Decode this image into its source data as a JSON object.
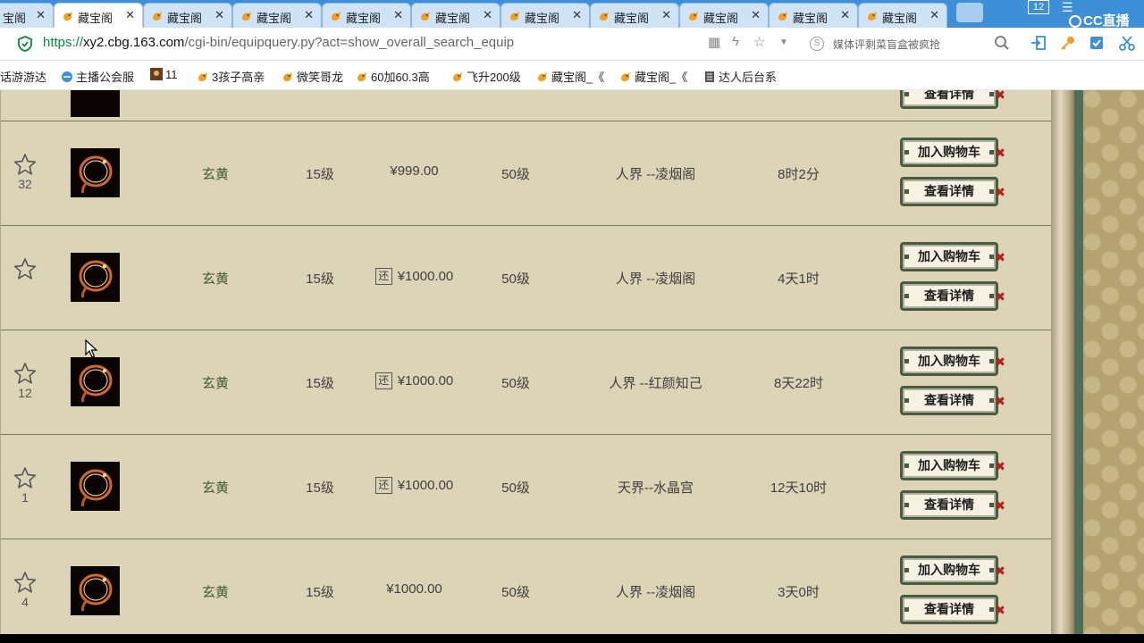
{
  "browser": {
    "tabs": [
      {
        "label": "宝阁",
        "close": "✕"
      },
      {
        "label": "藏宝阁",
        "close": "✕",
        "active": true
      },
      {
        "label": "藏宝阁",
        "close": "✕"
      },
      {
        "label": "藏宝阁",
        "close": "✕"
      },
      {
        "label": "藏宝阁",
        "close": "✕"
      },
      {
        "label": "藏宝阁",
        "close": "✕"
      },
      {
        "label": "藏宝阁",
        "close": "✕"
      },
      {
        "label": "藏宝阁",
        "close": "✕"
      },
      {
        "label": "藏宝阁",
        "close": "✕"
      },
      {
        "label": "藏宝阁",
        "close": "✕"
      },
      {
        "label": "藏宝阁",
        "close": "✕"
      }
    ],
    "tab_count": "12",
    "overlay_logo": "CC直播",
    "address": {
      "scheme": "https://",
      "host": "xy2.cbg.163.com",
      "path": "/cgi-bin/equipquery.py?act=show_overall_search_equip"
    },
    "search": {
      "placeholder": "媒体评剩菜盲盒被疯抢",
      "engine_icon": "S"
    },
    "bookmarks": [
      {
        "label": "话游游达"
      },
      {
        "label": "主播公会服"
      },
      {
        "label": "11"
      },
      {
        "label": "3孩子高亲"
      },
      {
        "label": "微笑哥龙"
      },
      {
        "label": "60加60.3高"
      },
      {
        "label": "飞升200级"
      },
      {
        "label": "藏宝阁_《"
      },
      {
        "label": "藏宝阁_《"
      },
      {
        "label": "达人后台系"
      }
    ],
    "colors": {
      "tab_strip": "#3d8fd8",
      "secure": "#0a8a3a",
      "bookmark_bird": "#f0a020"
    }
  },
  "listing": {
    "buttons": {
      "cart": "加入购物车",
      "detail": "查看详情"
    },
    "return_badge": "还",
    "rows": [
      {
        "fav_count": "32",
        "name": "玄黄",
        "level": "15级",
        "has_return": false,
        "price": "¥999.00",
        "grade": "50级",
        "server": "人界 --凌烟阁",
        "time_left": "8时2分"
      },
      {
        "fav_count": "",
        "name": "玄黄",
        "level": "15级",
        "has_return": true,
        "price": "¥1000.00",
        "grade": "50级",
        "server": "人界 --凌烟阁",
        "time_left": "4天1时"
      },
      {
        "fav_count": "12",
        "name": "玄黄",
        "level": "15级",
        "has_return": true,
        "price": "¥1000.00",
        "grade": "50级",
        "server": "人界 --红颜知己",
        "time_left": "8天22时"
      },
      {
        "fav_count": "1",
        "name": "玄黄",
        "level": "15级",
        "has_return": true,
        "price": "¥1000.00",
        "grade": "50级",
        "server": "天界--水晶宫",
        "time_left": "12天10时"
      },
      {
        "fav_count": "4",
        "name": "玄黄",
        "level": "15级",
        "has_return": false,
        "price": "¥1000.00",
        "grade": "50级",
        "server": "人界 --凌烟阁",
        "time_left": "3天0时"
      }
    ],
    "colors": {
      "background": "#ddd3b6",
      "row_border": "#6e7d5e",
      "button_border": "#4c5a44",
      "button_accent": "#b8201c"
    }
  }
}
